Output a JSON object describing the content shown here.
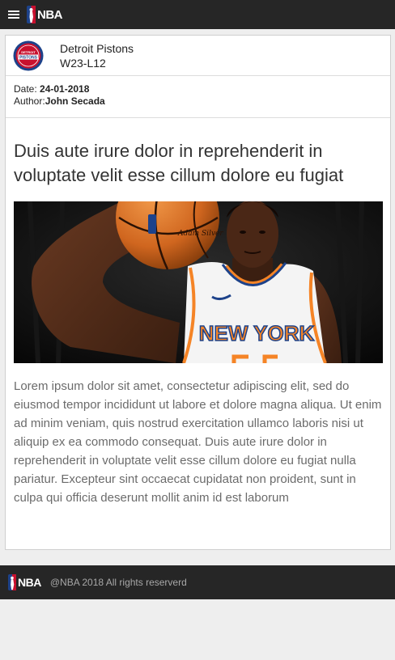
{
  "header": {
    "menu_icon": "hamburger-menu-icon",
    "logo_text": "NBA"
  },
  "team": {
    "name": "Detroit Pistons",
    "record": "W23-L12",
    "logo_text_top": "DETROIT",
    "logo_text_main": "PISTONS"
  },
  "article": {
    "date_label": "Date: ",
    "date": "24-01-2018",
    "author_label": "Author:",
    "author": "John Secada",
    "title": "Duis aute irure dolor in reprehenderit in voluptate velit esse cillum dolore eu fugiat",
    "image_jersey_text": "NEW YORK",
    "body": "Lorem ipsum dolor sit amet, consectetur adipiscing elit, sed do eiusmod tempor incididunt ut labore et dolore magna aliqua. Ut enim ad minim veniam, quis nostrud exercitation ullamco laboris nisi ut aliquip ex ea commodo consequat. Duis aute irure dolor in reprehenderit in voluptate velit esse cillum dolore eu fugiat nulla pariatur. Excepteur sint occaecat cupidatat non proident, sunt in culpa qui officia deserunt mollit anim id est laborum"
  },
  "footer": {
    "logo_text": "NBA",
    "copyright": "@NBA 2018 All rights reserverd"
  },
  "colors": {
    "bar_background": "#262626",
    "page_background": "#eeeeee",
    "pistons_red": "#c8102e",
    "pistons_blue": "#1d428a",
    "knicks_orange": "#f58426",
    "knicks_blue": "#006bb6"
  }
}
